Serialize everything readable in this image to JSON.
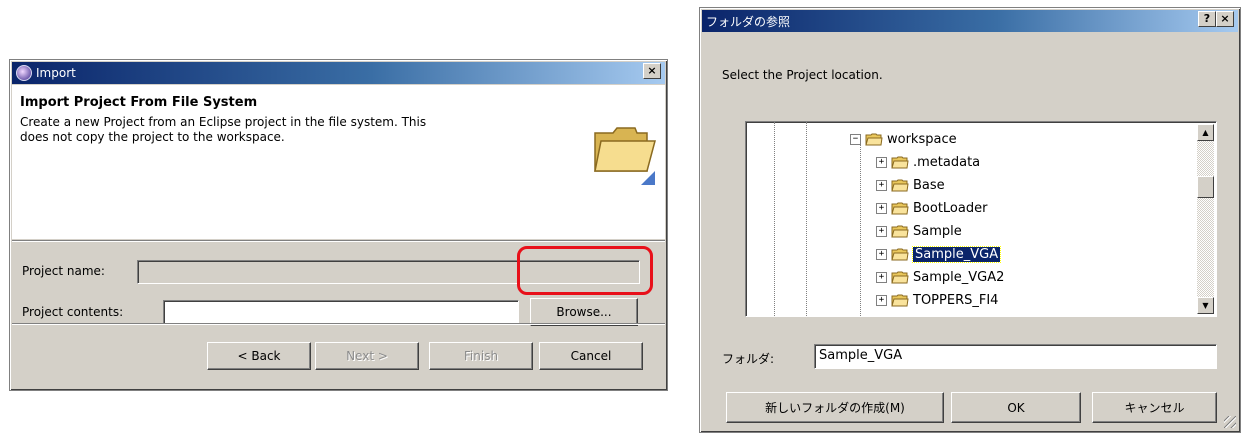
{
  "import_dialog": {
    "title": "Import",
    "close_glyph": "×",
    "heading": "Import Project From File System",
    "description": "Create a new Project from an Eclipse project in the file system. This\ndoes not copy the project to the workspace.",
    "header_icon": "folder-wizard-icon",
    "project_name_label": "Project name:",
    "project_name_value": "",
    "project_contents_label": "Project contents:",
    "project_contents_value": "",
    "browse_label": "Browse...",
    "back_label": "< Back",
    "next_label": "Next >",
    "finish_label": "Finish",
    "cancel_label": "Cancel"
  },
  "browse_dialog": {
    "title": "フォルダの参照",
    "help_glyph": "?",
    "close_glyph": "×",
    "instruction": "Select the Project location.",
    "tree": [
      {
        "label": "workspace",
        "expander": "−",
        "level": 0,
        "selected": false
      },
      {
        "label": ".metadata",
        "expander": "+",
        "level": 1,
        "selected": false
      },
      {
        "label": "Base",
        "expander": "+",
        "level": 1,
        "selected": false
      },
      {
        "label": "BootLoader",
        "expander": "+",
        "level": 1,
        "selected": false
      },
      {
        "label": "Sample",
        "expander": "+",
        "level": 1,
        "selected": false
      },
      {
        "label": "Sample_VGA",
        "expander": "+",
        "level": 1,
        "selected": true
      },
      {
        "label": "Sample_VGA2",
        "expander": "+",
        "level": 1,
        "selected": false
      },
      {
        "label": "TOPPERS_FI4",
        "expander": "+",
        "level": 1,
        "selected": false
      }
    ],
    "folder_label": "フォルダ:",
    "folder_value": "Sample_VGA",
    "new_folder_label": "新しいフォルダの作成(M)",
    "ok_label": "OK",
    "cancel_label": "キャンセル"
  },
  "colors": {
    "titlebar_start": "#0a246a",
    "highlight_ring": "#e8101a",
    "selection": "#0a246a"
  }
}
